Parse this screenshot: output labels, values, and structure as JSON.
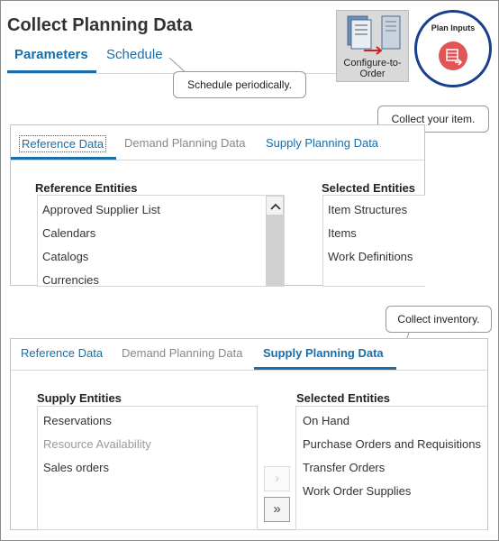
{
  "header": {
    "title": "Collect Planning Data",
    "tabs": [
      {
        "label": "Parameters",
        "active": true
      },
      {
        "label": "Schedule",
        "active": false
      }
    ]
  },
  "callouts": {
    "schedule": "Schedule periodically.",
    "item": "Collect your item.",
    "inventory": "Collect inventory."
  },
  "icons": {
    "configure_to_order": {
      "name": "configure-to-order-icon",
      "label": "Configure-to-Order"
    },
    "plan_inputs": {
      "name": "plan-inputs-icon",
      "label": "Plan Inputs",
      "accent": "#e05555",
      "ring": "#1a3f8c"
    }
  },
  "reference_panel": {
    "tabs": [
      "Reference Data",
      "Demand Planning Data",
      "Supply Planning Data"
    ],
    "active_tab": "Reference Data",
    "left_header": "Reference Entities",
    "left_items": [
      "Approved Supplier List",
      "Calendars",
      "Catalogs",
      "Currencies"
    ],
    "right_header": "Selected Entities",
    "right_items": [
      "Item Structures",
      "Items",
      "Work Definitions"
    ]
  },
  "supply_panel": {
    "tabs": [
      "Reference Data",
      "Demand Planning Data",
      "Supply Planning Data"
    ],
    "active_tab": "Supply Planning Data",
    "left_header": "Supply Entities",
    "left_items": [
      "Reservations",
      "Resource Availability",
      "Sales orders"
    ],
    "right_header": "Selected Entities",
    "right_items": [
      "On Hand",
      "Purchase Orders and Requisitions",
      "Transfer Orders",
      "Work Order Supplies"
    ],
    "move_one": "›",
    "move_all": "»"
  },
  "colors": {
    "accent": "#1a6ea8",
    "dim_text": "#888888"
  }
}
